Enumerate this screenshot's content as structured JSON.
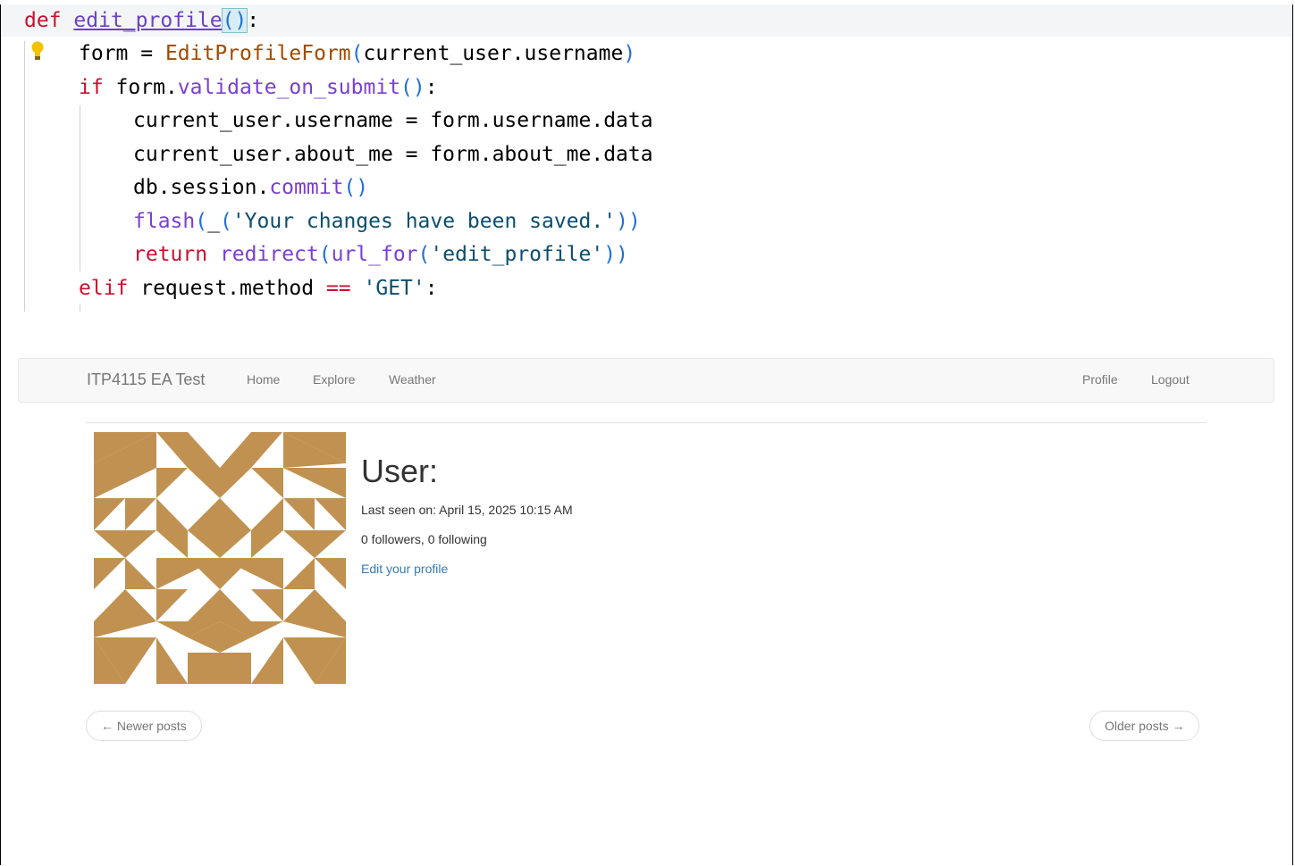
{
  "code": {
    "def_keyword": "def",
    "function_name": "edit_profile",
    "l2_var": "form = ",
    "l2_class": "EditProfileForm",
    "l2_arg": "current_user.username",
    "l3_kw": "if",
    "l3_obj": " form.",
    "l3_meth": "validate_on_submit",
    "l4": "current_user.username = form.username.data",
    "l5": "current_user.about_me = form.about_me.data",
    "l6_obj": "db.session.",
    "l6_meth": "commit",
    "l7_meth": "flash",
    "l7_under": "_",
    "l7_str": "'Your changes have been saved.'",
    "l8_kw": "return",
    "l8_meth": "redirect",
    "l8_meth2": "url_for",
    "l8_str": "'edit_profile'",
    "l9_kw": "elif",
    "l9_obj": " request.method ",
    "l9_op": "==",
    "l9_str": "'GET'"
  },
  "navbar": {
    "brand": "ITP4115 EA Test",
    "links": [
      "Home",
      "Explore",
      "Weather"
    ],
    "right_links": [
      "Profile",
      "Logout"
    ]
  },
  "profile": {
    "title": "User:",
    "last_seen": "Last seen on: April 15, 2025 10:15 AM",
    "follow_counts": "0 followers, 0 following",
    "edit_link": "Edit your profile",
    "avatar_color": "#c09151"
  },
  "pager": {
    "newer": "← Newer posts",
    "older": "Older posts →"
  }
}
